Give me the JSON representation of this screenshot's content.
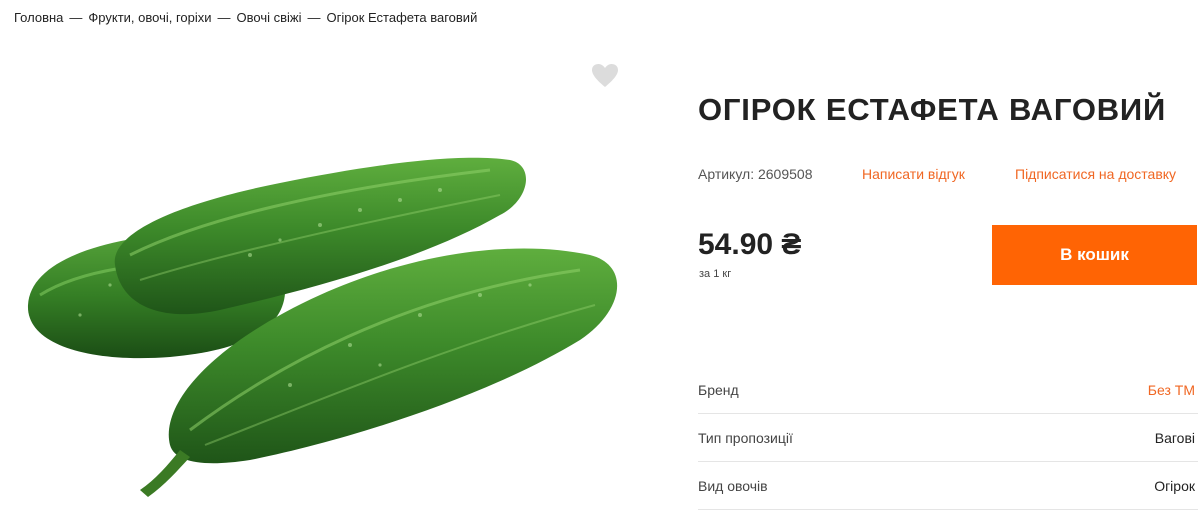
{
  "breadcrumb": {
    "items": [
      "Головна",
      "Фрукти, овочі, горіхи",
      "Овочі свіжі",
      "Огірок Естафета ваговий"
    ],
    "separator": "—"
  },
  "product": {
    "title": "ОГІРОК ЕСТАФЕТА ВАГОВИЙ",
    "sku": "Артикул: 2609508",
    "review_link": "Написати відгук",
    "subscribe_link": "Підписатися на доставку",
    "price": "54.90 ₴",
    "price_unit": "за 1 кг",
    "cart_button": "В кошик",
    "image_icon": "cucumber-image",
    "favorite_icon": "heart-icon"
  },
  "specs": [
    {
      "label": "Бренд",
      "value": "Без ТМ"
    },
    {
      "label": "Тип пропозиції",
      "value": "Вагові"
    },
    {
      "label": "Вид овочів",
      "value": "Огірок"
    }
  ],
  "colors": {
    "accent": "#ff6404",
    "link": "#f06723",
    "cucumber_dark": "#2c6a1f",
    "cucumber_light": "#52a536",
    "heart": "#dcdcdc"
  }
}
